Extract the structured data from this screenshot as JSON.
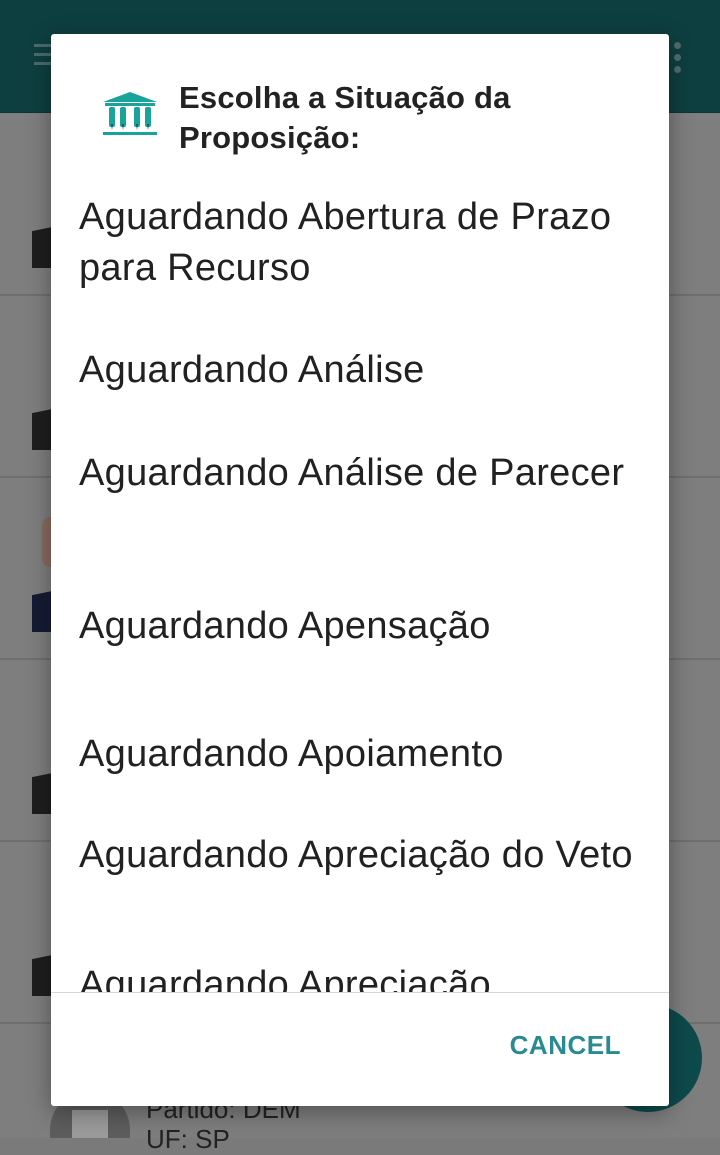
{
  "background": {
    "bottom_lines": [
      "Partido: DEM",
      "UF: SP"
    ]
  },
  "dialog": {
    "title": "Escolha a Situação da Proposição:",
    "icon": "institution-building-icon",
    "options": [
      "Aguardando Abertura de Prazo para Recurso",
      "Aguardando Análise",
      "Aguardando Análise de Parecer",
      "Aguardando Apensação",
      "Aguardando Apoiamento",
      "Aguardando Apreciação do Veto",
      "Aguardando Apreciação"
    ],
    "cancel_label": "CANCEL"
  },
  "colors": {
    "accent": "#2a8a94",
    "icon_teal": "#1aa39a",
    "app_bar": "#1b7f80"
  }
}
